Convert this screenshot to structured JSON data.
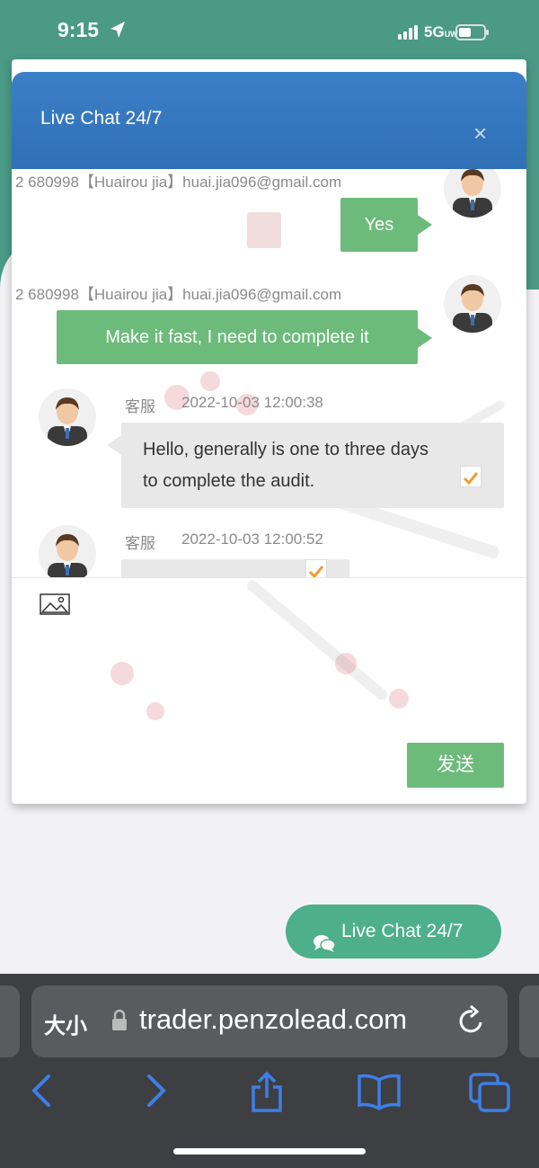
{
  "status_bar": {
    "time": "9:15",
    "network": "5G",
    "network_sub": "UW"
  },
  "chat": {
    "title": "Live Chat 24/7",
    "close_label": "×",
    "messages": [
      {
        "side": "right",
        "meta": "2    680998【Huairou jia】huai.jia096@gmail.com",
        "text": "Yes"
      },
      {
        "side": "right",
        "meta": "2    680998【Huairou jia】huai.jia096@gmail.com",
        "text": "Make it fast, I need to complete it"
      },
      {
        "side": "left",
        "sender": "客服",
        "time": "2022-10-03 12:00:38",
        "text_line1": "Hello, generally is one to three days",
        "text_line2": "to complete the audit."
      },
      {
        "side": "left",
        "sender": "客服",
        "time": "2022-10-03 12:00:52",
        "text_line1": ""
      }
    ],
    "send_label": "发送",
    "icons": {
      "image": "image-icon",
      "close": "close-icon",
      "read": "checkmark-icon"
    }
  },
  "floating_button": {
    "label": "Live Chat 24/7",
    "icon": "chat-bubbles-icon"
  },
  "browser": {
    "text_size_label": "大小",
    "url": "trader.penzolead.com",
    "icons": [
      "back-icon",
      "forward-icon",
      "share-icon",
      "bookmarks-icon",
      "tabs-icon"
    ]
  },
  "colors": {
    "header_blue": "#3b7fc8",
    "bubble_green": "#6cbb7a",
    "page_teal": "#4a9a86",
    "floating_green": "#4daf8c",
    "safari_bar": "#3e3f42",
    "ios_blue": "#3d7fe8"
  }
}
